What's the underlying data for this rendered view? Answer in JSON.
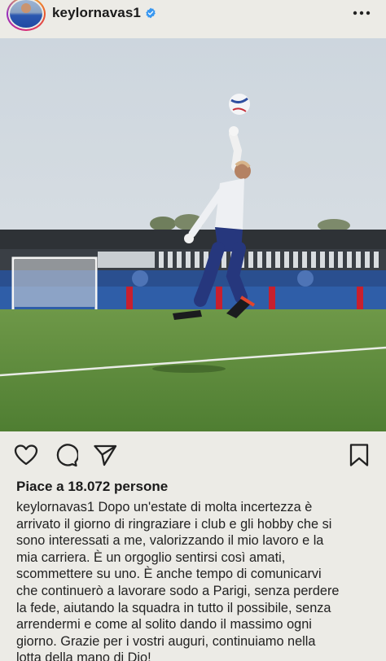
{
  "post": {
    "username": "keylornavas1",
    "verified": true,
    "more_icon": "more-horizontal-icon"
  },
  "actions": {
    "like_icon": "heart-icon",
    "comment_icon": "comment-icon",
    "share_icon": "send-icon",
    "save_icon": "bookmark-icon"
  },
  "likes_text": "Piace a 18.072 persone",
  "caption": {
    "username": "keylornavas1",
    "lines": [
      " Dopo un'estate di molta incertezza è",
      "arrivato il giorno di ringraziare i club e gli hobby che si",
      "sono interessati a me, valorizzando il mio lavoro e la",
      "mia carriera. È un orgoglio sentirsi così amati,",
      "scommettere su uno. È anche tempo di comunicarvi",
      "che continuerò a lavorare sodo a Parigi, senza perdere",
      "la fede, aiutando la squadra in tutto il possibile, senza",
      "arrendermi e come al solito dando il massimo ogni",
      "giorno. Grazie per i vostri auguri, continuiamo nella",
      "lotta della mano di Dio!"
    ]
  },
  "colors": {
    "background": "#ecebe6",
    "verified_blue": "#3897f0",
    "grass": "#5f8a3f",
    "sky": "#cfd6dc"
  }
}
